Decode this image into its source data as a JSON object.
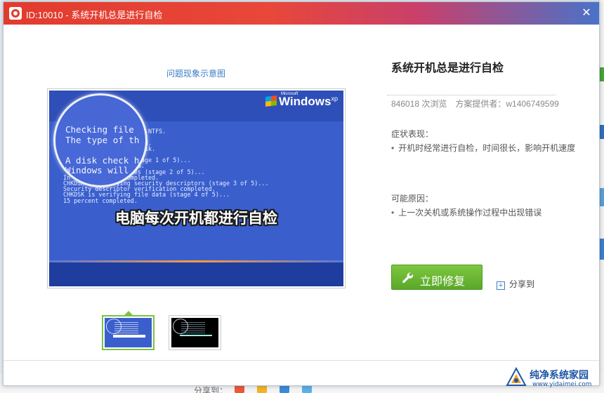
{
  "window": {
    "title": "ID:10010 - 系统开机总是进行自检",
    "close_glyph": "✕"
  },
  "left": {
    "caption": "问题现象示意图",
    "preview": {
      "windows_logo_small": "Microsoft",
      "windows_logo": "Windows",
      "windows_logo_sup": "xp",
      "magnified_text": "Checking file\nThe type of th\n\nA disk check h\nWindows will",
      "console_text": "               n c:\n               ystem is NTFS.\n\n               scheduled.\n               f the disk.\n\n               les (stage 1 of 5)...\n               mpleted.\n               indexes (stage 2 of 5)...\nIn             n completed.\nCHKDSK is verifying security descriptors (stage 3 of 5)...\nSecurity descriptor verification completed.\nCHKDSK is verifying file data (stage 4 of 5)...\n15 percent completed.",
      "overlay_caption": "电脑每次开机都进行自检"
    },
    "thumbnails": [
      {
        "state": "active",
        "bg": "#3a5fcd"
      },
      {
        "state": "inactive",
        "bg": "#000000"
      }
    ]
  },
  "right": {
    "title": "系统开机总是进行自检",
    "views": "846018 次浏览",
    "provider": "方案提供者：w1406749599",
    "symptom_label": "症状表现：",
    "symptom_item": "开机时经常进行自检，时间很长，影响开机速度",
    "cause_label": "可能原因：",
    "cause_item": "上一次关机或系统操作过程中出现错误",
    "fix_button": "立即修复",
    "share_label": "分享到"
  },
  "background": {
    "share_label": "分享到："
  },
  "watermark": {
    "name": "纯净系统家园",
    "url": "www.yidaimei.com"
  },
  "colors": {
    "accent_green": "#6cb835",
    "link_blue": "#3a7dc7",
    "title_red": "#e23b2e"
  }
}
